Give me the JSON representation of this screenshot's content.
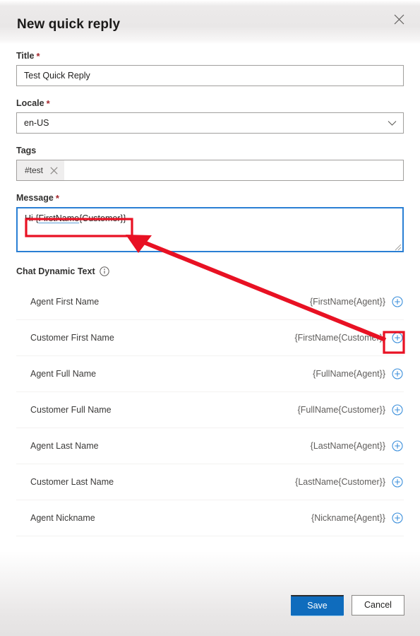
{
  "dialog": {
    "title": "New quick reply",
    "close_icon": "close-icon"
  },
  "form": {
    "title_field": {
      "label": "Title",
      "required_marker": "*",
      "value": "Test Quick Reply"
    },
    "locale_field": {
      "label": "Locale",
      "required_marker": "*",
      "value": "en-US",
      "chevron_icon": "chevron-down-icon"
    },
    "tags_field": {
      "label": "Tags",
      "chip": "#test",
      "chip_remove_icon": "close-icon"
    },
    "message_field": {
      "label": "Message",
      "required_marker": "*",
      "prefix": "Hi ",
      "token_open": "{",
      "token_underlined": "FirstName",
      "token_rest": "{Customer}}"
    }
  },
  "dynamic_text": {
    "heading": "Chat Dynamic Text",
    "info_icon": "info-icon",
    "add_icon": "add-circle-icon",
    "rows": [
      {
        "label": "Agent First Name",
        "token": "{FirstName{Agent}}"
      },
      {
        "label": "Customer First Name",
        "token": "{FirstName{Customer}}"
      },
      {
        "label": "Agent Full Name",
        "token": "{FullName{Agent}}"
      },
      {
        "label": "Customer Full Name",
        "token": "{FullName{Customer}}"
      },
      {
        "label": "Agent Last Name",
        "token": "{LastName{Agent}}"
      },
      {
        "label": "Customer Last Name",
        "token": "{LastName{Customer}}"
      },
      {
        "label": "Agent Nickname",
        "token": "{Nickname{Agent}}"
      }
    ]
  },
  "footer": {
    "save_label": "Save",
    "cancel_label": "Cancel"
  },
  "colors": {
    "primary_button": "#0f6cbd",
    "focus_border": "#2a7fd4",
    "annotation": "#e81123",
    "required_asterisk": "#a4262c",
    "add_icon": "#3b8fdb"
  }
}
